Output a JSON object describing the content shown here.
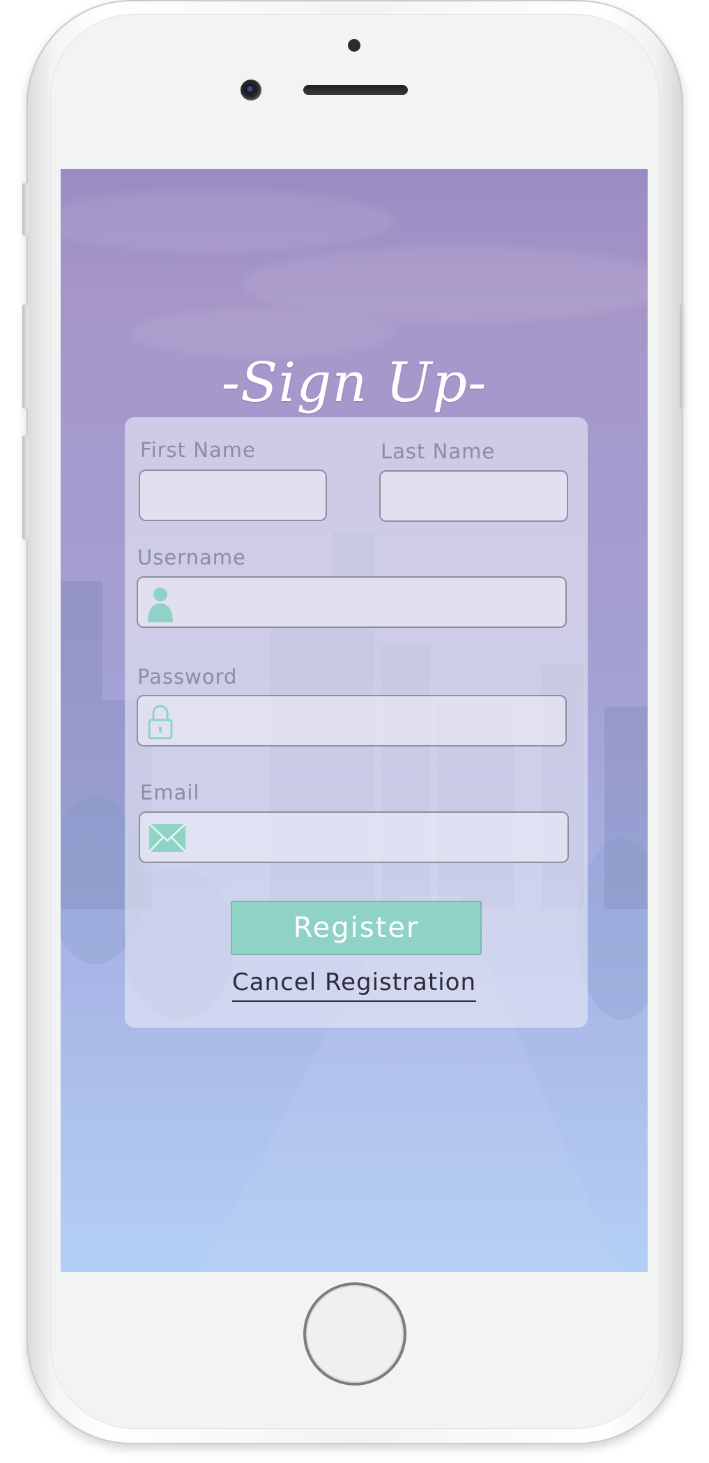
{
  "screen": {
    "title": "-Sign Up-",
    "form": {
      "first_name_label": "First Name",
      "last_name_label": "Last Name",
      "username_label": "Username",
      "password_label": "Password",
      "email_label": "Email",
      "first_name_value": "",
      "last_name_value": "",
      "username_value": "",
      "password_value": "",
      "email_value": ""
    },
    "register_label": "Register",
    "cancel_label": "Cancel Registration"
  },
  "icons": {
    "username": "user-icon",
    "password": "padlock-icon",
    "email": "envelope-icon"
  },
  "colors": {
    "accent": "#8fd3c6",
    "label": "#8c8ca4",
    "gradient_top": "#9a8bc3",
    "gradient_bottom": "#b3cff5"
  }
}
